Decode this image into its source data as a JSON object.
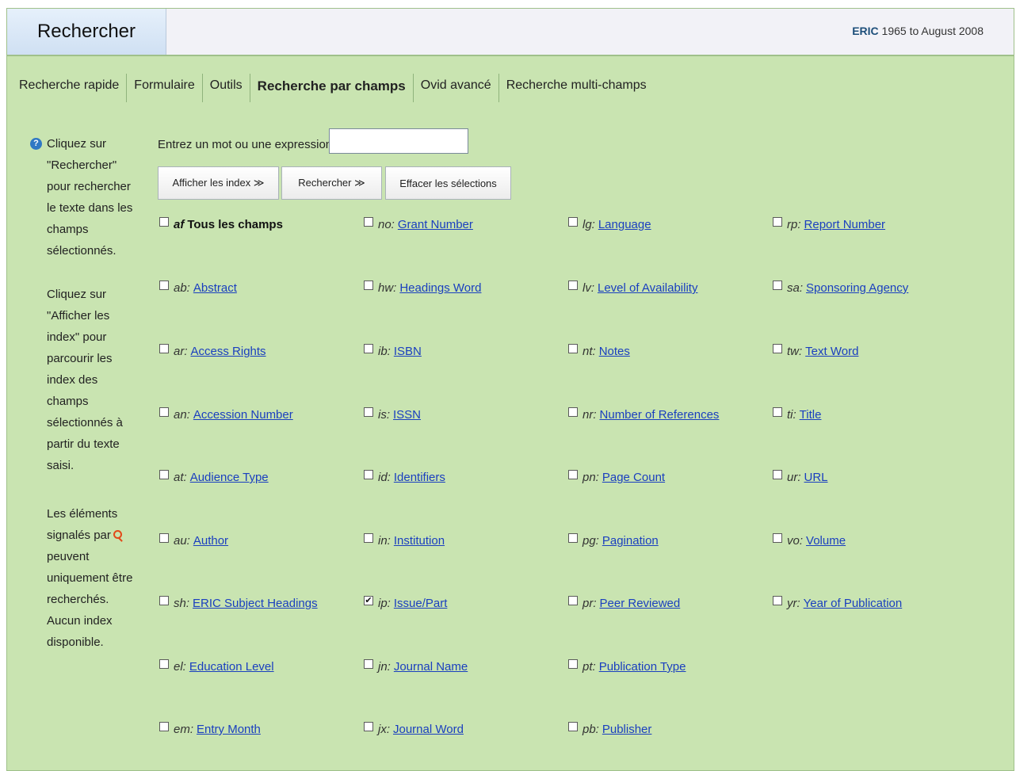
{
  "header": {
    "title": "Rechercher",
    "db_name": "ERIC",
    "db_range": "1965 to August 2008"
  },
  "tabs": [
    {
      "label": "Recherche rapide"
    },
    {
      "label": "Formulaire"
    },
    {
      "label": "Outils"
    },
    {
      "label": "Recherche par champs",
      "active": true
    },
    {
      "label": "Ovid avancé"
    },
    {
      "label": "Recherche multi-champs"
    }
  ],
  "help": {
    "p1": "Cliquez sur \"Rechercher\" pour rechercher le texte dans les champs sélectionnés.",
    "p2": "Cliquez sur \"Afficher les index\" pour parcourir les index des champs sélectionnés à partir du texte saisi.",
    "p3_a": "Les éléments signalés par",
    "p3_b": "peuvent uniquement être recherchés. Aucun index disponible."
  },
  "search": {
    "label": "Entrez un mot ou une expression :",
    "value": ""
  },
  "buttons": {
    "show_index": "Afficher les index ≫",
    "search": "Rechercher ≫",
    "clear": "Effacer les sélections"
  },
  "fields": {
    "af": {
      "abbr": "af",
      "label": "Tous les champs",
      "checked": false
    },
    "ab": {
      "abbr": "ab:",
      "label": "Abstract",
      "checked": false
    },
    "ar": {
      "abbr": "ar:",
      "label": "Access Rights",
      "checked": false
    },
    "an": {
      "abbr": "an:",
      "label": "Accession Number",
      "checked": false
    },
    "at": {
      "abbr": "at:",
      "label": "Audience Type",
      "checked": false
    },
    "au": {
      "abbr": "au:",
      "label": "Author",
      "checked": false
    },
    "sh": {
      "abbr": "sh:",
      "label": "ERIC Subject Headings",
      "checked": false
    },
    "el": {
      "abbr": "el:",
      "label": "Education Level",
      "checked": false
    },
    "em": {
      "abbr": "em:",
      "label": "Entry Month",
      "checked": false
    },
    "no": {
      "abbr": "no:",
      "label": "Grant Number",
      "checked": false
    },
    "hw": {
      "abbr": "hw:",
      "label": "Headings Word",
      "checked": false
    },
    "ib": {
      "abbr": "ib:",
      "label": "ISBN",
      "checked": false
    },
    "is": {
      "abbr": "is:",
      "label": "ISSN",
      "checked": false
    },
    "id": {
      "abbr": "id:",
      "label": "Identifiers",
      "checked": false
    },
    "in": {
      "abbr": "in:",
      "label": "Institution",
      "checked": false
    },
    "ip": {
      "abbr": "ip:",
      "label": "Issue/Part",
      "checked": true
    },
    "jn": {
      "abbr": "jn:",
      "label": "Journal Name",
      "checked": false
    },
    "jx": {
      "abbr": "jx:",
      "label": "Journal Word",
      "checked": false
    },
    "lg": {
      "abbr": "lg:",
      "label": "Language",
      "checked": false
    },
    "lv": {
      "abbr": "lv:",
      "label": "Level of Availability",
      "checked": false
    },
    "nt": {
      "abbr": "nt:",
      "label": "Notes",
      "checked": false
    },
    "nr": {
      "abbr": "nr:",
      "label": "Number of References",
      "checked": false
    },
    "pn": {
      "abbr": "pn:",
      "label": "Page Count",
      "checked": false
    },
    "pg": {
      "abbr": "pg:",
      "label": "Pagination",
      "checked": false
    },
    "pr": {
      "abbr": "pr:",
      "label": "Peer Reviewed",
      "checked": false
    },
    "pt": {
      "abbr": "pt:",
      "label": "Publication Type",
      "checked": false
    },
    "pb": {
      "abbr": "pb:",
      "label": "Publisher",
      "checked": false
    },
    "rp": {
      "abbr": "rp:",
      "label": "Report Number",
      "checked": false
    },
    "sa": {
      "abbr": "sa:",
      "label": "Sponsoring Agency",
      "checked": false
    },
    "tw": {
      "abbr": "tw:",
      "label": "Text Word",
      "checked": false
    },
    "ti": {
      "abbr": "ti:",
      "label": "Title",
      "checked": false
    },
    "ur": {
      "abbr": "ur:",
      "label": "URL",
      "checked": false
    },
    "vo": {
      "abbr": "vo:",
      "label": "Volume",
      "checked": false
    },
    "yr": {
      "abbr": "yr:",
      "label": "Year of Publication",
      "checked": false
    }
  },
  "colors": {
    "panel_bg": "#c9e4b1",
    "link": "#1a3fbf",
    "header_bg": "#f2f2f7"
  }
}
